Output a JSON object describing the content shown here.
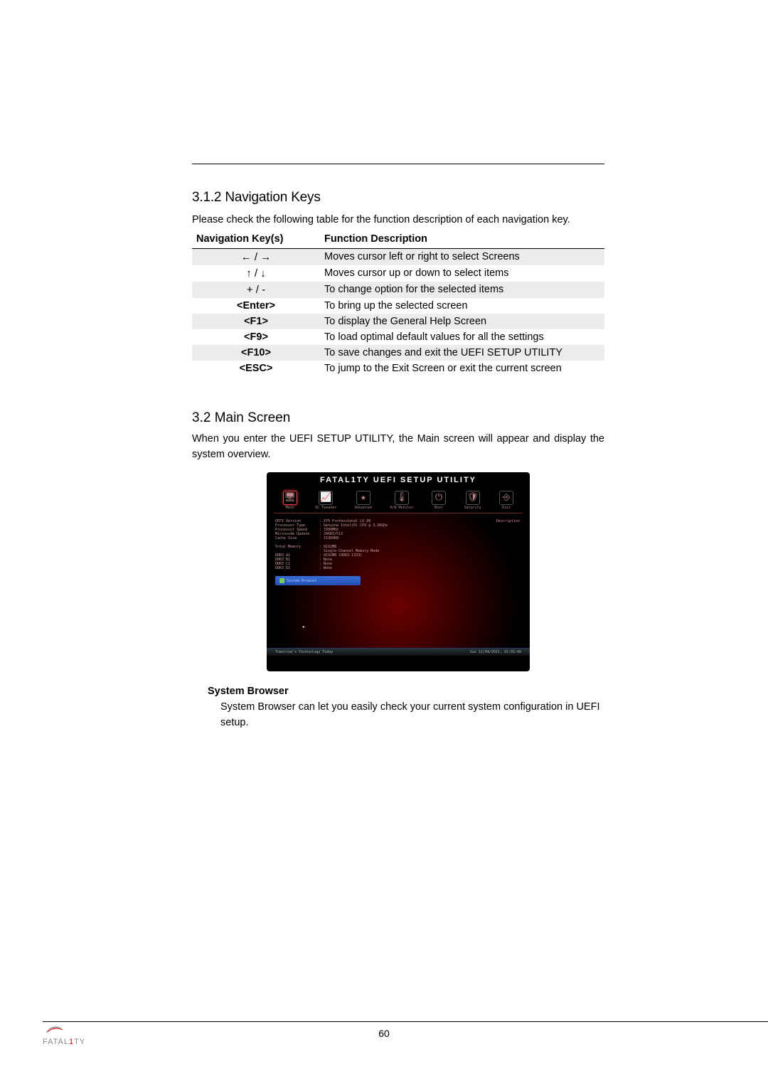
{
  "section_312_title": "3.1.2  Navigation Keys",
  "section_312_body": "Please check the following table for the function description of each navigation key.",
  "nav_table": {
    "header": {
      "col1": "Navigation Key(s)",
      "col2": "Function Description"
    },
    "rows": [
      {
        "key": "← / →",
        "desc": "Moves cursor left or right to select Screens",
        "sym": true
      },
      {
        "key": "↑ / ↓",
        "desc": "Moves cursor up or down to select items",
        "sym": true
      },
      {
        "key": "+  /  -",
        "desc": "To change option for the selected items",
        "sym": true
      },
      {
        "key": "<Enter>",
        "desc": "To bring up the selected screen",
        "sym": false
      },
      {
        "key": "<F1>",
        "desc": "To display the General Help Screen",
        "sym": false
      },
      {
        "key": "<F9>",
        "desc": "To load optimal default values for all the settings",
        "sym": false
      },
      {
        "key": "<F10>",
        "desc": "To save changes and exit the UEFI SETUP UTILITY",
        "sym": false
      },
      {
        "key": "<ESC>",
        "desc": "To jump to the Exit Screen or exit the current screen",
        "sym": false
      }
    ]
  },
  "section_32_title": "3.2  Main Screen",
  "section_32_body": "When you enter the UEFI SETUP UTILITY, the Main screen will appear and display the system overview.",
  "uefi": {
    "title": "FATAL1TY UEFI SETUP UTILITY",
    "tabs": [
      "Main",
      "OC Tweaker",
      "Advanced",
      "H/W Monitor",
      "Boot",
      "Security",
      "Exit"
    ],
    "desc_label": "Description",
    "info": [
      {
        "lbl": "UEFI Version",
        "val": "X79 Professional L0.06"
      },
      {
        "lbl": "Processor Type",
        "val": "Genuine Intel(R) CPU @ 3.30GHz"
      },
      {
        "lbl": "Processor Speed",
        "val": "3300MHz"
      },
      {
        "lbl": "Microcode Update",
        "val": "206D5/513"
      },
      {
        "lbl": "Cache Size",
        "val": "15360KB"
      }
    ],
    "mem_header": {
      "lbl": "Total Memory",
      "val": "8192MB"
    },
    "mem_mode": "Single-Channel Memory Mode",
    "slots": [
      {
        "lbl": "DDR3_A1",
        "val": "8192MB  (DDR3-1333)"
      },
      {
        "lbl": "DDR3_B1",
        "val": "None"
      },
      {
        "lbl": "DDR3_C1",
        "val": "None"
      },
      {
        "lbl": "DDR3_D1",
        "val": "None"
      }
    ],
    "sysbrowser_btn": "System Browser",
    "footer_left": "Tomorrow's Technology Today",
    "footer_right": "Sun  12/04/2011,  15:02:48"
  },
  "sysb_heading": "System Browser",
  "sysb_text": "System Browser can let you easily check your current system configuration in UEFI setup.",
  "page_num": "60",
  "brand": {
    "part1": "FATAL",
    "part2": "1",
    "part3": "TY"
  }
}
